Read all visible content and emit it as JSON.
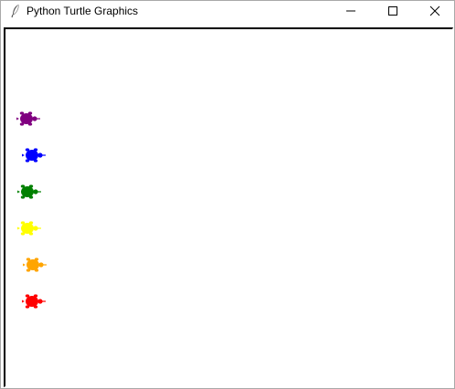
{
  "window": {
    "title": "Python Turtle Graphics",
    "icon": "feather-icon",
    "controls": [
      "minimize-icon",
      "maximize-icon",
      "close-icon"
    ]
  },
  "canvas": {
    "background": "#ffffff",
    "turtles": [
      {
        "name": "turtle-purple",
        "color": "#800080"
      },
      {
        "name": "turtle-blue",
        "color": "#0000ff"
      },
      {
        "name": "turtle-green",
        "color": "#008000"
      },
      {
        "name": "turtle-yellow",
        "color": "#ffff00"
      },
      {
        "name": "turtle-orange",
        "color": "#ffa500"
      },
      {
        "name": "turtle-red",
        "color": "#ff0000"
      }
    ]
  }
}
